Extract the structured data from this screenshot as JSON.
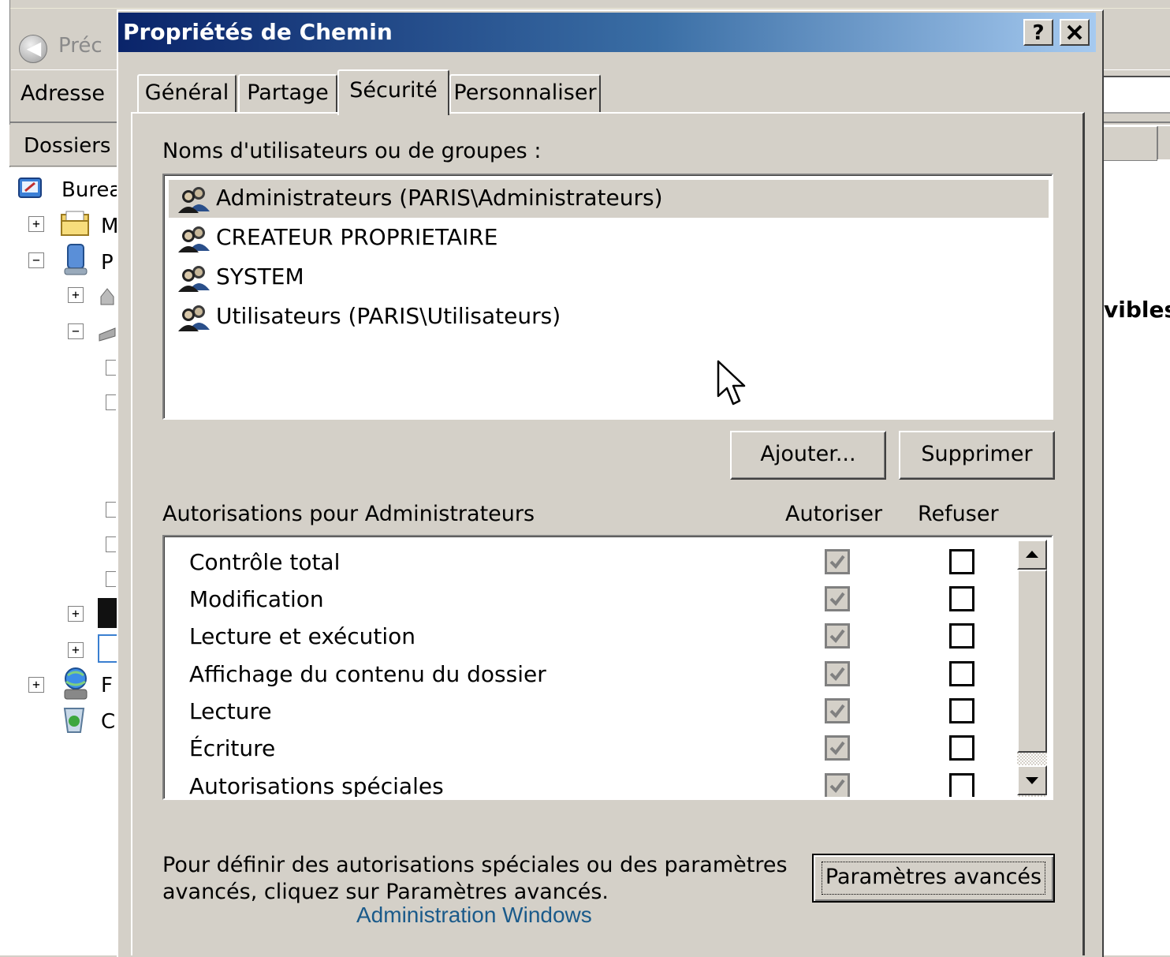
{
  "background_window": {
    "back_label": "Préc",
    "address_label": "Adresse",
    "folders_label": "Dossiers",
    "tree_items": [
      {
        "label": "Burea"
      },
      {
        "label": "M"
      },
      {
        "label": "P"
      },
      {
        "label": "F"
      },
      {
        "label": "C"
      }
    ],
    "right_text": "vibles"
  },
  "dialog": {
    "title": "Propriétés de Chemin",
    "help_button": "?",
    "close_button": "✕",
    "tabs": [
      {
        "label": "Général",
        "active": false
      },
      {
        "label": "Partage",
        "active": false
      },
      {
        "label": "Sécurité",
        "active": true
      },
      {
        "label": "Personnaliser",
        "active": false
      }
    ],
    "users_label": "Noms d'utilisateurs ou de groupes :",
    "users": [
      {
        "name": "Administrateurs (PARIS\\Administrateurs)",
        "selected": true
      },
      {
        "name": "CREATEUR PROPRIETAIRE",
        "selected": false
      },
      {
        "name": "SYSTEM",
        "selected": false
      },
      {
        "name": "Utilisateurs (PARIS\\Utilisateurs)",
        "selected": false
      }
    ],
    "add_button": "Ajouter...",
    "remove_button": "Supprimer",
    "permissions_label": "Autorisations pour Administrateurs",
    "allow_header": "Autoriser",
    "deny_header": "Refuser",
    "permissions": [
      {
        "name": "Contrôle total",
        "allow": true,
        "deny": false
      },
      {
        "name": "Modification",
        "allow": true,
        "deny": false
      },
      {
        "name": "Lecture et exécution",
        "allow": true,
        "deny": false
      },
      {
        "name": "Affichage du contenu du dossier",
        "allow": true,
        "deny": false
      },
      {
        "name": "Lecture",
        "allow": true,
        "deny": false
      },
      {
        "name": "Écriture",
        "allow": true,
        "deny": false
      },
      {
        "name": "Autorisations spéciales",
        "allow": true,
        "deny": false
      }
    ],
    "advanced_text_line1": "Pour définir des autorisations spéciales ou des paramètres",
    "advanced_text_line2": "avancés, cliquez sur Paramètres avancés.",
    "advanced_button": "Paramètres avancés"
  },
  "watermark": "Administration Windows",
  "colors": {
    "title_start": "#0a246a",
    "title_end": "#a6caf0",
    "face": "#d4d0c8",
    "watermark": "#1a5a8a"
  }
}
